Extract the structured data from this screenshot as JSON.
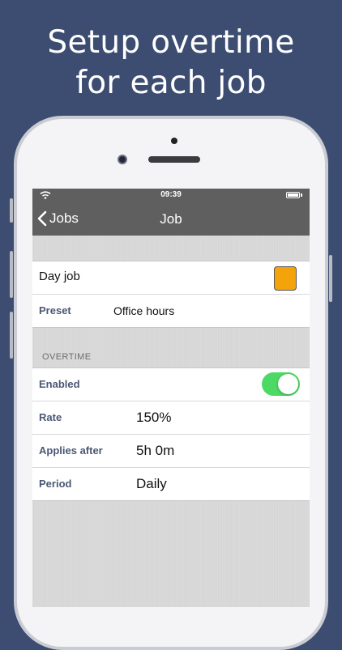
{
  "promo": {
    "headline_line1": "Setup overtime",
    "headline_line2": "for each job"
  },
  "status_bar": {
    "time": "09:39"
  },
  "nav": {
    "back_label": "Jobs",
    "title": "Job"
  },
  "job": {
    "name": "Day job",
    "color": "#f5a30a",
    "preset_label": "Preset",
    "preset_value": "Office hours"
  },
  "overtime": {
    "section_title": "OVERTIME",
    "enabled_label": "Enabled",
    "enabled": true,
    "rate_label": "Rate",
    "rate_value": "150%",
    "applies_after_label": "Applies after",
    "applies_after_value": "5h 0m",
    "period_label": "Period",
    "period_value": "Daily"
  },
  "colors": {
    "background": "#3d4d72",
    "navbar": "#5f5f5f",
    "toggle_on": "#4cd964",
    "label": "#4a5774"
  }
}
